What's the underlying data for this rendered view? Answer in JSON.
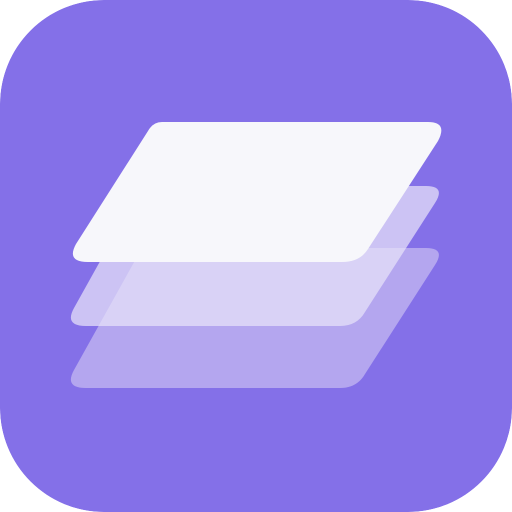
{
  "icon": {
    "name": "layers-icon",
    "colors": {
      "background": "#8470e8",
      "layer_top": "#f7f7fb",
      "layer_middle": "#e7e3f8",
      "layer_bottom": "#d2c8f4"
    },
    "layer_opacity": {
      "top": 1,
      "middle": 0.72,
      "bottom": 0.62
    }
  }
}
